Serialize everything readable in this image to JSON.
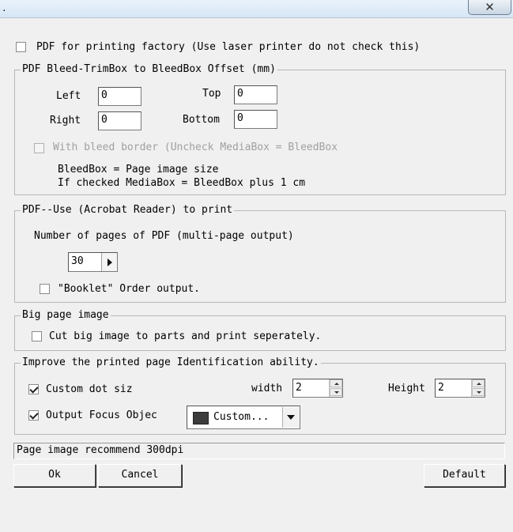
{
  "titlebar": {
    "dot": ".",
    "close_glyph": "✕"
  },
  "pdf_factory": {
    "label": "PDF for printing factory (Use laser printer do not check this)",
    "checked": false
  },
  "bleed_group": {
    "legend": "PDF Bleed-TrimBox to BleedBox Offset (mm)",
    "left_label": "Left",
    "left_value": "0",
    "top_label": "Top",
    "top_value": "0",
    "right_label": "Right",
    "right_value": "0",
    "bottom_label": "Bottom",
    "bottom_value": "0",
    "bleed_border_label": "With bleed border (Uncheck MediaBox = BleedBox",
    "note_line1": "BleedBox = Page image size",
    "note_line2": "If checked MediaBox = BleedBox plus 1 cm"
  },
  "acrobat_group": {
    "legend": "PDF--Use (Acrobat Reader) to print",
    "pages_label": "Number of pages of PDF (multi-page output)",
    "pages_value": "30",
    "booklet_label": "\"Booklet\" Order output."
  },
  "bigpage_group": {
    "legend": "Big page image",
    "cut_label": "Cut big image to parts and print seperately."
  },
  "identify_group": {
    "legend": "Improve the printed page Identification ability.",
    "dot_size_label": "Custom dot siz",
    "width_label": "width",
    "width_value": "2",
    "height_label": "Height",
    "height_value": "2",
    "focus_label": "Output Focus Objec",
    "color_select_label": "Custom...",
    "swatch_color": "#3c3c3c"
  },
  "status_text": "Page image recommend 300dpi",
  "buttons": {
    "ok": "Ok",
    "cancel": "Cancel",
    "default": "Default"
  }
}
